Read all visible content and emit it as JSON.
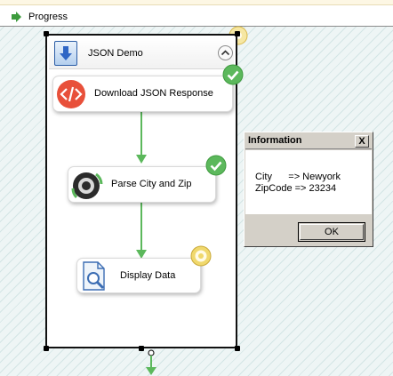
{
  "tabs": [
    {
      "label": "Progress",
      "icon": "progress-arrow-icon"
    }
  ],
  "container": {
    "title": "JSON Demo",
    "icon": "sequence-container-icon",
    "collapse_icon": "chevron-up-icon"
  },
  "tasks": [
    {
      "label": "Download JSON Response",
      "icon": "code-brackets-icon",
      "status": "success"
    },
    {
      "label": "Parse City and Zip",
      "icon": "script-cog-icon",
      "status": "success"
    },
    {
      "label": "Display Data",
      "icon": "document-search-icon",
      "status": "running"
    }
  ],
  "dialog": {
    "title": "Information",
    "close_label": "X",
    "lines": [
      "City      => Newyork",
      "ZipCode => 23234"
    ],
    "ok_label": "OK"
  },
  "colors": {
    "success": "#5cb85c",
    "running": "#f0d86c",
    "connector": "#5cb85c",
    "task_icon_red": "#e8503a"
  }
}
